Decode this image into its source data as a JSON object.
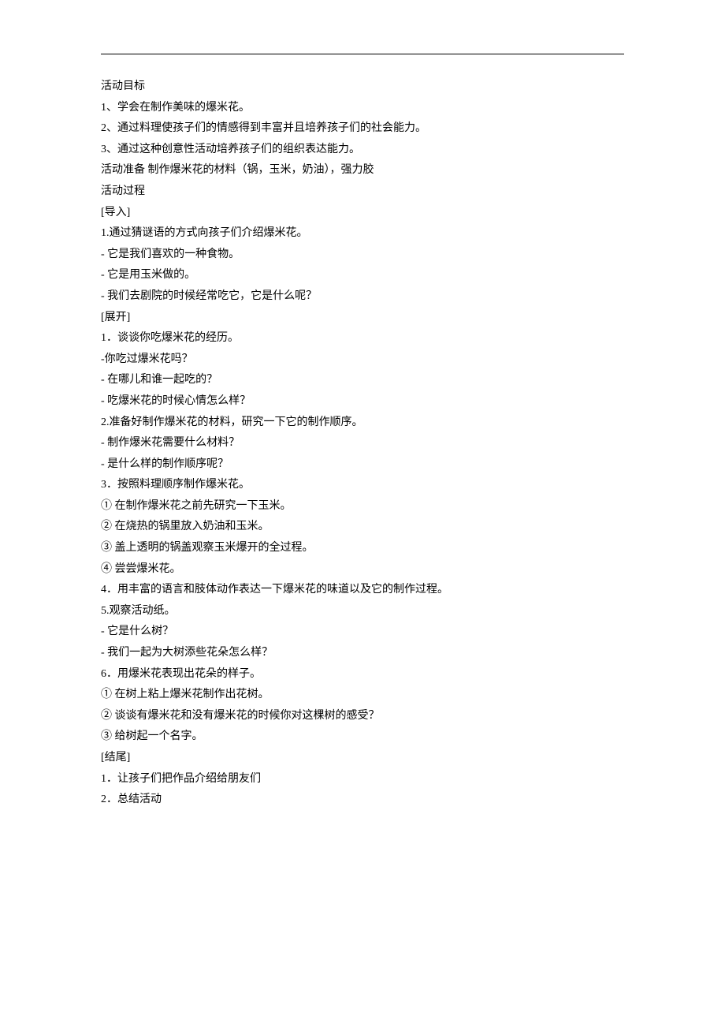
{
  "lines": [
    "活动目标",
    "1、学会在制作美味的爆米花。",
    "2、通过料理使孩子们的情感得到丰富并且培养孩子们的社会能力。",
    "3、通过这种创意性活动培养孩子们的组织表达能力。",
    "活动准备 制作爆米花的材料（锅，玉米，奶油），强力胶",
    "活动过程",
    "[导入]",
    "1.通过猜谜语的方式向孩子们介绍爆米花。",
    "- 它是我们喜欢的一种食物。",
    "- 它是用玉米做的。",
    "- 我们去剧院的时候经常吃它，它是什么呢？",
    "[展开]",
    "1．谈谈你吃爆米花的经历。",
    "-你吃过爆米花吗？",
    "- 在哪儿和谁一起吃的？",
    "- 吃爆米花的时候心情怎么样？",
    "2.准备好制作爆米花的材料，研究一下它的制作顺序。",
    "- 制作爆米花需要什么材料？",
    "- 是什么样的制作顺序呢？",
    "3．按照料理顺序制作爆米花。",
    "① 在制作爆米花之前先研究一下玉米。",
    "② 在烧热的锅里放入奶油和玉米。",
    "③ 盖上透明的锅盖观察玉米爆开的全过程。",
    "④ 尝尝爆米花。",
    "4．用丰富的语言和肢体动作表达一下爆米花的味道以及它的制作过程。",
    "5.观察活动纸。",
    "- 它是什么树？",
    "- 我们一起为大树添些花朵怎么样？",
    "6．用爆米花表现出花朵的样子。",
    "① 在树上粘上爆米花制作出花树。",
    "② 谈谈有爆米花和没有爆米花的时候你对这棵树的感受？",
    "③ 给树起一个名字。",
    "[结尾]",
    "1．让孩子们把作品介绍给朋友们",
    "2．总结活动"
  ]
}
